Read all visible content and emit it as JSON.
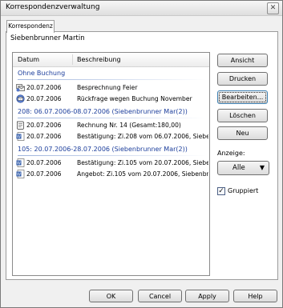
{
  "window": {
    "title": "Korrespondenzverwaltung",
    "close_glyph": "✕"
  },
  "tabs": [
    {
      "label": "Korrespondenz"
    }
  ],
  "owner_name": "Siebenbrunner Martin",
  "list": {
    "columns": {
      "date": "Datum",
      "description": "Beschreibung"
    },
    "groups": [
      {
        "label": "Ohne Buchung",
        "items": [
          {
            "icon": "envelopes-icon",
            "date": "20.07.2006",
            "description": "Besprechnung Feier"
          },
          {
            "icon": "email-icon",
            "date": "20.07.2006",
            "description": "Rückfrage wegen Buchung November"
          }
        ]
      },
      {
        "label": "208: 06.07.2006-08.07.2006 (Siebenbrunner Mar(2))",
        "items": [
          {
            "icon": "invoice-icon",
            "date": "20.07.2006",
            "description": "Rechnung Nr. 14 (Gesamt:180,00)"
          },
          {
            "icon": "word-document-icon",
            "date": "20.07.2006",
            "description": "Bestätigung: Zi.208 vom 06.07.2006, Siebe"
          }
        ]
      },
      {
        "label": "105: 20.07.2006-28.07.2006 (Siebenbrunner Mar(2))",
        "items": [
          {
            "icon": "word-document-icon",
            "date": "20.07.2006",
            "description": "Bestätigung: Zi.105 vom 20.07.2006, Siebe"
          },
          {
            "icon": "word-document-icon",
            "date": "20.07.2006",
            "description": "Angebot: Zi.105 vom 20.07.2006, Siebenbr"
          }
        ]
      }
    ]
  },
  "actions": {
    "ansicht": "Ansicht",
    "drucken": "Drucken",
    "bearbeiten": "Bearbeiten...",
    "loeschen": "Löschen",
    "neu": "Neu"
  },
  "anzeige": {
    "label": "Anzeige:",
    "value": "Alle",
    "arrow": "▼"
  },
  "gruppiert": {
    "label": "Gruppiert",
    "checked": true,
    "glyph": "✓"
  },
  "footer": {
    "ok": "OK",
    "cancel": "Cancel",
    "apply": "Apply",
    "help": "Help"
  }
}
